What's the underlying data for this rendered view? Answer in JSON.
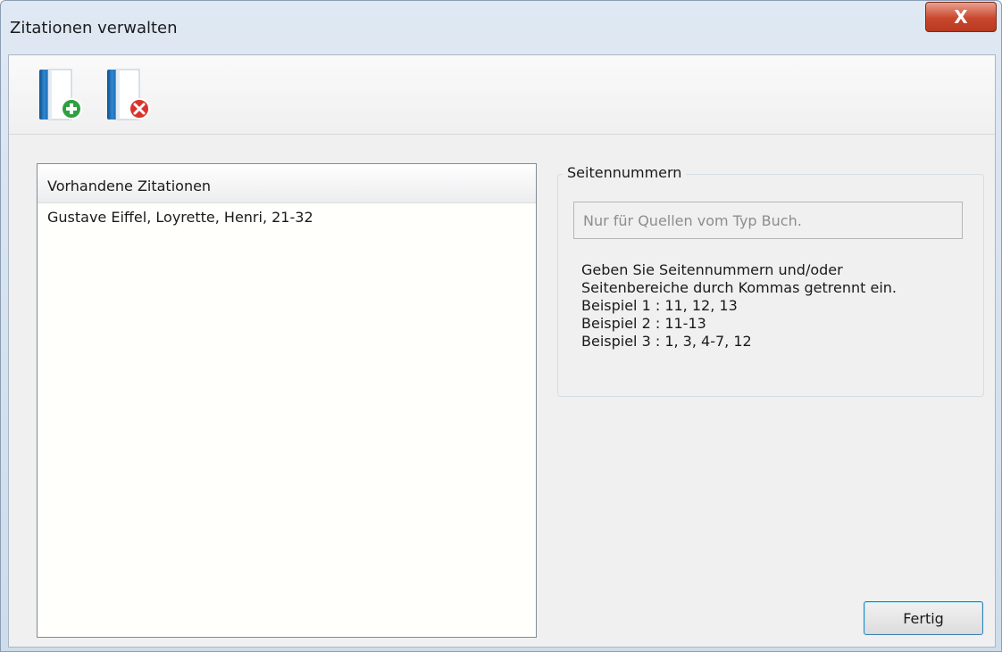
{
  "window": {
    "title": "Zitationen verwalten",
    "close_label": "X"
  },
  "toolbar": {
    "add_icon": "book-add-icon",
    "remove_icon": "book-delete-icon"
  },
  "citations_list": {
    "header": "Vorhandene Zitationen",
    "items": [
      "Gustave Eiffel, Loyrette, Henri, 21-32"
    ]
  },
  "page_numbers": {
    "group_label": "Seitennummern",
    "input_value": "",
    "input_placeholder": "Nur für Quellen vom Typ Buch.",
    "help_lines": [
      "Geben Sie Seitennummern und/oder",
      "Seitenbereiche durch Kommas getrennt ein.",
      "Beispiel 1 : 11, 12, 13",
      "Beispiel 2 : 11-13",
      "Beispiel 3 : 1, 3, 4-7, 12"
    ]
  },
  "footer": {
    "done_label": "Fertig"
  },
  "colors": {
    "title_gradient_top": "#dfe8f3",
    "client_bg": "#f0f0f0",
    "close_red": "#c9472d",
    "default_button_border": "#3c7fb1"
  }
}
